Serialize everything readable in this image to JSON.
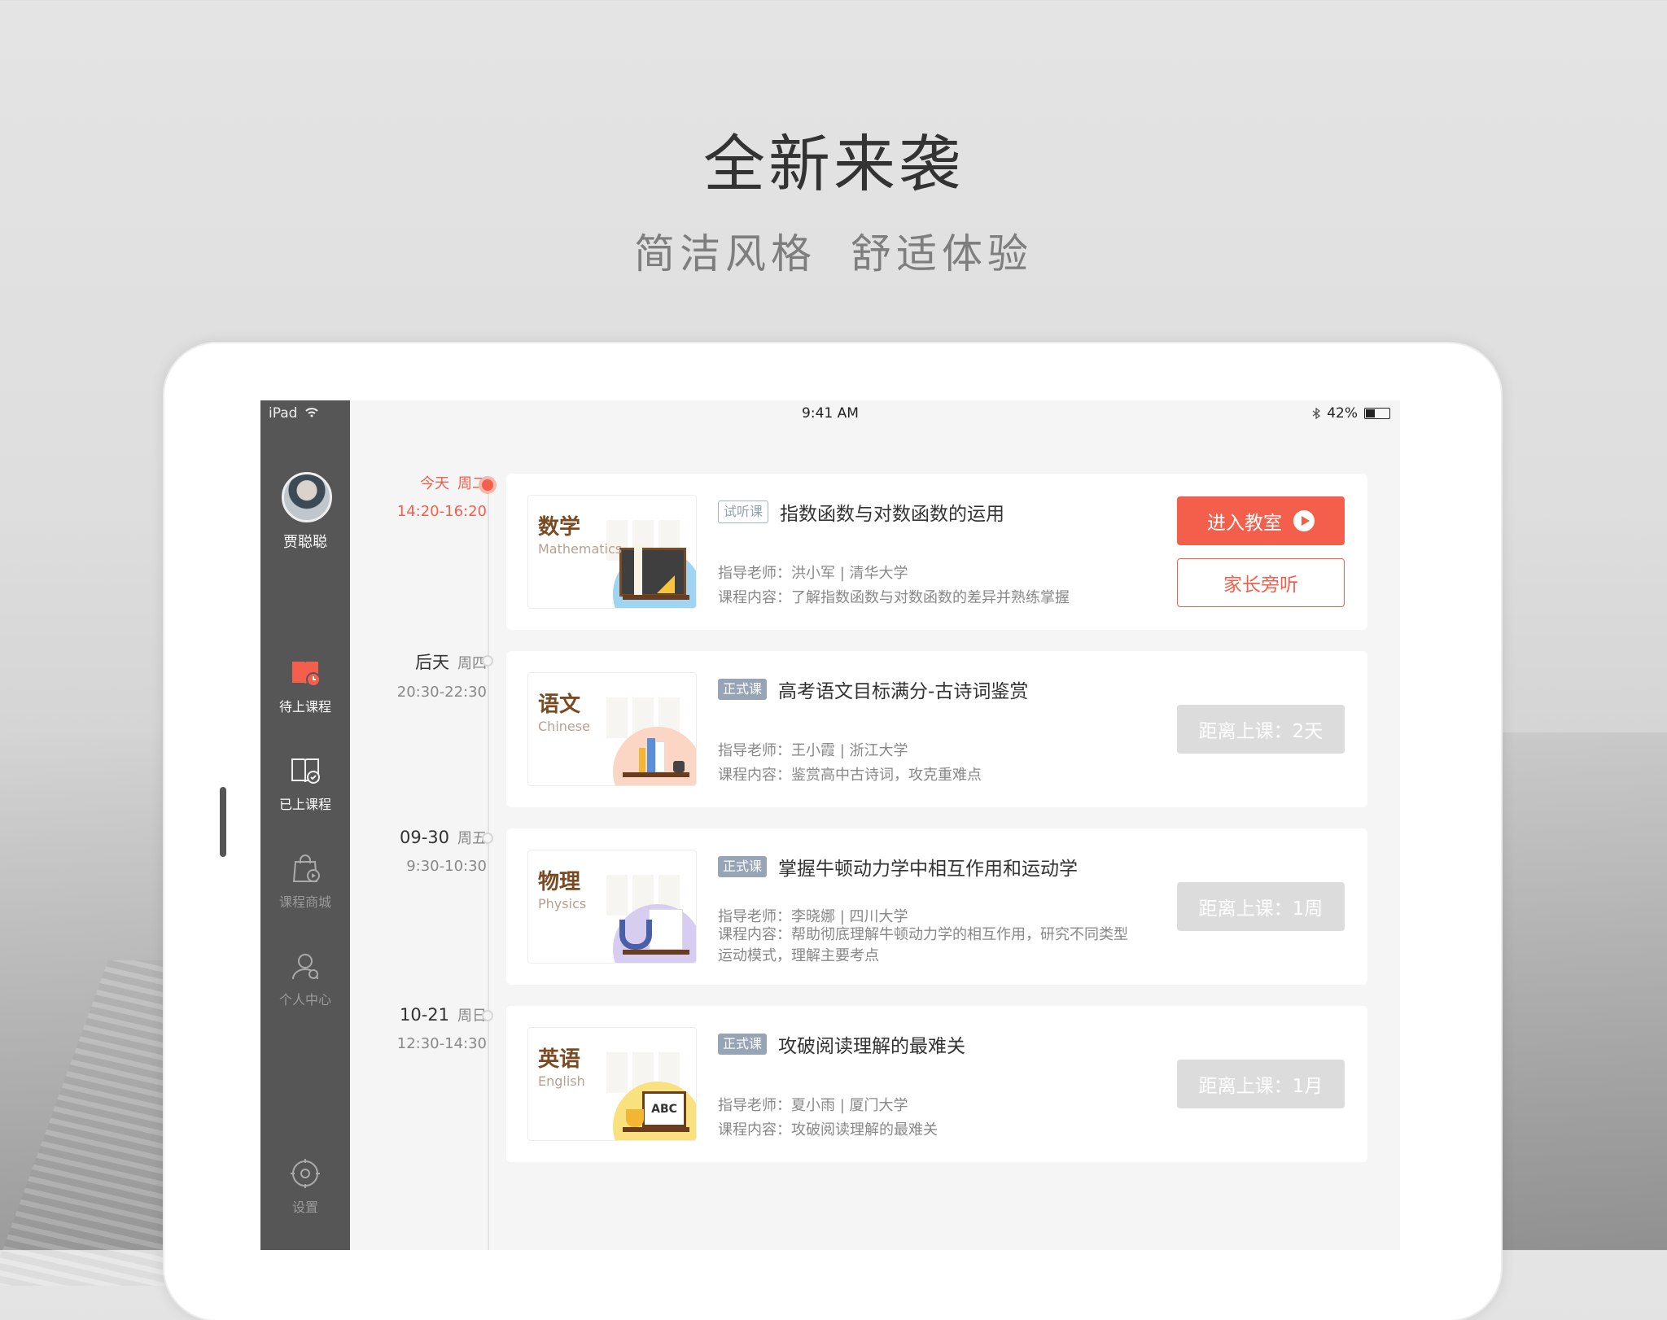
{
  "hero": {
    "title": "全新来袭",
    "subtitle": "简洁风格  舒适体验"
  },
  "statusbar": {
    "device": "iPad",
    "time": "9:41 AM",
    "battery": "42%"
  },
  "sidebar": {
    "user_name": "贾聪聪",
    "items": [
      {
        "label": "待上课程",
        "icon": "book-clock-icon",
        "active": true
      },
      {
        "label": "已上课程",
        "icon": "book-check-icon",
        "active": false
      },
      {
        "label": "课程商城",
        "icon": "shopping-bag-icon",
        "active": false
      },
      {
        "label": "个人中心",
        "icon": "user-icon",
        "active": false
      }
    ],
    "settings_label": "设置"
  },
  "courses": [
    {
      "day": "今天",
      "weekday": "周二",
      "time": "14:20-16:20",
      "subject_cn": "数学",
      "subject_en": "Mathematics",
      "accent": "#9fd4f2",
      "tag": "试听课",
      "title": "指数函数与对数函数的运用",
      "teacher": "指导老师：洪小军 | 清华大学",
      "content": "课程内容：了解指数函数与对数函数的差异并熟练掌握",
      "primary_button": "进入教室",
      "secondary_button": "家长旁听"
    },
    {
      "day": "后天",
      "weekday": "周四",
      "time": "20:30-22:30",
      "subject_cn": "语文",
      "subject_en": "Chinese",
      "accent": "#fbd6c4",
      "tag": "正式课",
      "title": "高考语文目标满分-古诗词鉴赏",
      "teacher": "指导老师：王小霞 | 浙江大学",
      "content": "课程内容：鉴赏高中古诗词，攻克重难点",
      "countdown": "距离上课：2天"
    },
    {
      "day": "09-30",
      "weekday": "周五",
      "time": "9:30-10:30",
      "subject_cn": "物理",
      "subject_en": "Physics",
      "accent": "#d6cdf1",
      "tag": "正式课",
      "title": "掌握牛顿动力学中相互作用和运动学",
      "teacher": "指导老师：李晓娜 | 四川大学",
      "content": "课程内容：帮助彻底理解牛顿动力学的相互作用，研究不同类型运动模式，理解主要考点",
      "countdown": "距离上课：1周"
    },
    {
      "day": "10-21",
      "weekday": "周日",
      "time": "12:30-14:30",
      "subject_cn": "英语",
      "subject_en": "English",
      "accent": "#f9e27d",
      "tag": "正式课",
      "title": "攻破阅读理解的最难关",
      "teacher": "指导老师：夏小雨 | 厦门大学",
      "content": "课程内容：攻破阅读理解的最难关",
      "countdown": "距离上课：1月"
    }
  ]
}
